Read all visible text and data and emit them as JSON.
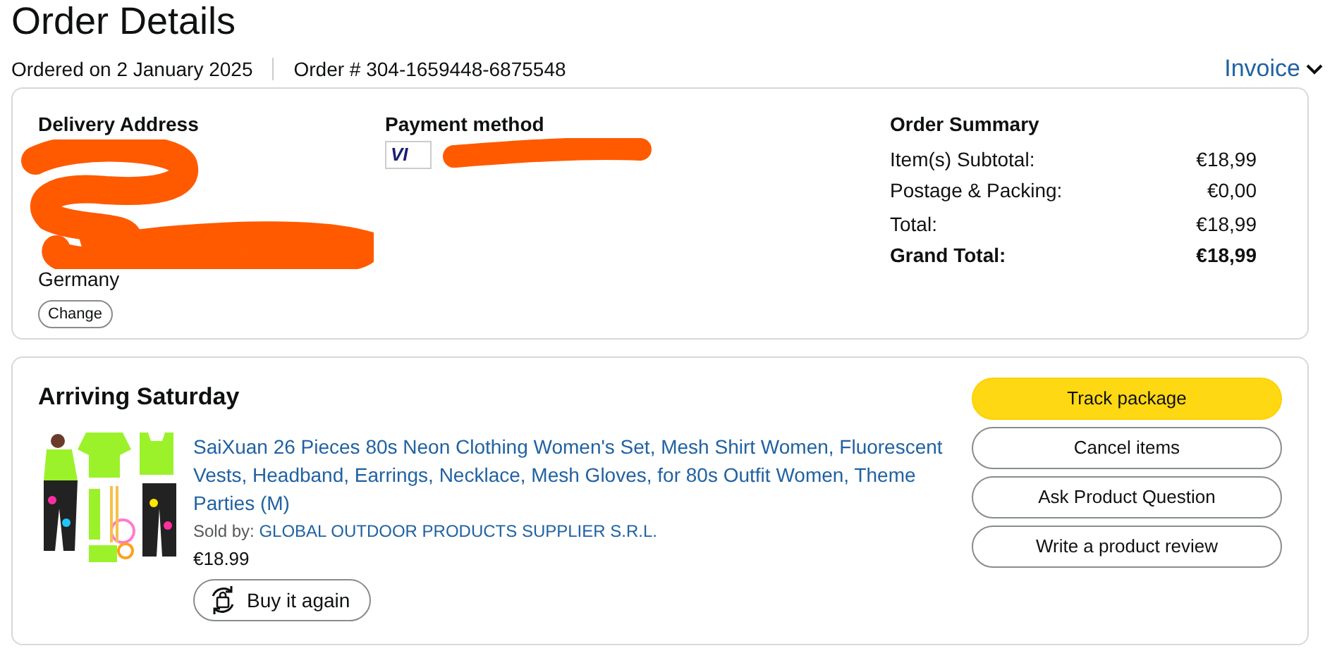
{
  "page_title": "Order Details",
  "order_date": "Ordered on 2 January 2025",
  "order_number": "Order # 304-1659448-6875548",
  "invoice_link": "Invoice",
  "delivery_address": {
    "heading": "Delivery Address",
    "country": "Germany",
    "change_button": "Change"
  },
  "payment_method": {
    "heading": "Payment method",
    "card_logo": "VI"
  },
  "order_summary": {
    "heading": "Order Summary",
    "rows": [
      {
        "label": "Item(s) Subtotal:",
        "value": "€18,99",
        "bold": false
      },
      {
        "label": "Postage & Packing:",
        "value": "€0,00",
        "bold": false
      },
      {
        "label": "Total:",
        "value": "€18,99",
        "bold": false
      },
      {
        "label": "Grand Total:",
        "value": "€18,99",
        "bold": true
      }
    ]
  },
  "shipment": {
    "heading": "Arriving Saturday",
    "item": {
      "title": "SaiXuan 26 Pieces 80s Neon Clothing Women's Set, Mesh Shirt Women, Fluorescent Vests, Headband, Earrings, Necklace, Mesh Gloves, for 80s Outfit Women, Theme Parties (M)",
      "sold_by_label": "Sold by:",
      "seller": "GLOBAL OUTDOOR PRODUCTS SUPPLIER S.R.L.",
      "price": "€18.99",
      "buy_again_button": "Buy it again"
    },
    "actions": [
      {
        "label": "Track package",
        "kind": "primary"
      },
      {
        "label": "Cancel items",
        "kind": "secondary"
      },
      {
        "label": "Ask Product Question",
        "kind": "secondary"
      },
      {
        "label": "Write a product review",
        "kind": "secondary"
      }
    ]
  }
}
